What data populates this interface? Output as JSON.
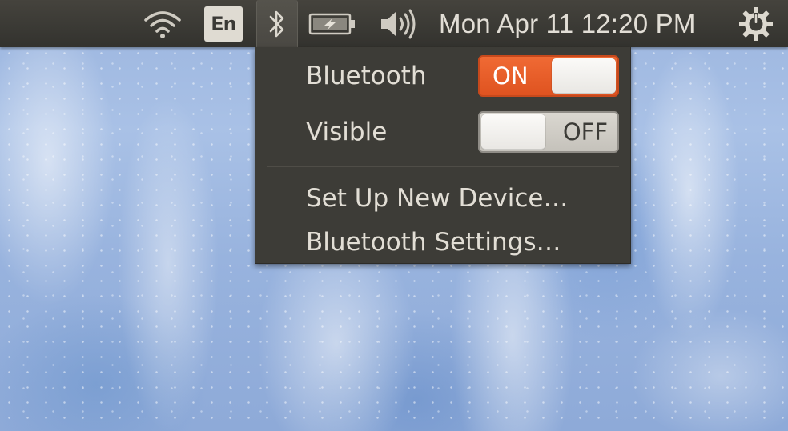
{
  "panel": {
    "keyboard_layout": "En",
    "clock": "Mon Apr 11 12:20 PM",
    "icons": {
      "wifi": "wifi-icon",
      "keyboard": "keyboard-layout-icon",
      "bluetooth": "bluetooth-icon",
      "battery": "battery-charging-icon",
      "sound": "volume-icon",
      "session": "power-gear-icon"
    }
  },
  "bluetooth_menu": {
    "bluetooth_label": "Bluetooth",
    "bluetooth_switch": {
      "label": "ON",
      "state": "on"
    },
    "visible_label": "Visible",
    "visible_switch": {
      "label": "OFF",
      "state": "off"
    },
    "items": [
      {
        "label": "Set Up New Device…"
      },
      {
        "label": "Bluetooth Settings…"
      }
    ]
  },
  "colors": {
    "panel_bg": "#3c3b37",
    "menu_bg": "#3d3c37",
    "switch_on": "#e95420",
    "text": "#dfdbd2"
  }
}
